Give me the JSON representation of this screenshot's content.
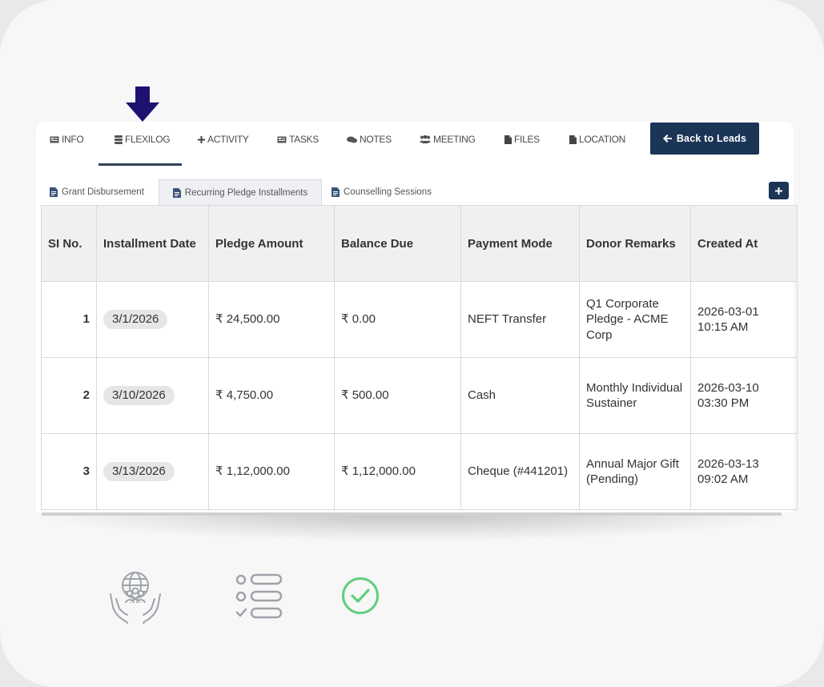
{
  "tabs": [
    {
      "label": "INFO",
      "icon": "id-card-icon"
    },
    {
      "label": "FLEXILOG",
      "icon": "database-icon"
    },
    {
      "label": "ACTIVITY",
      "icon": "plus-icon"
    },
    {
      "label": "TASKS",
      "icon": "id-card-icon"
    },
    {
      "label": "NOTES",
      "icon": "comments-icon"
    },
    {
      "label": "MEETING",
      "icon": "users-icon"
    },
    {
      "label": "FILES",
      "icon": "file-icon"
    },
    {
      "label": "LOCATION",
      "icon": "file-icon"
    }
  ],
  "active_tab": "FLEXILOG",
  "back_button": {
    "label": "Back to Leads",
    "icon": "arrow-left-icon"
  },
  "subtabs": [
    {
      "label": "Grant Disbursement",
      "icon": "document-icon"
    },
    {
      "label": "Recurring Pledge Installments",
      "icon": "document-icon"
    },
    {
      "label": "Counselling Sessions",
      "icon": "document-icon"
    }
  ],
  "active_subtab": "Recurring Pledge Installments",
  "table": {
    "columns": [
      "SI No.",
      "Installment Date",
      "Pledge Amount",
      "Balance Due",
      "Payment Mode",
      "Donor Remarks",
      "Created At"
    ],
    "rows": [
      {
        "si": "1",
        "date": "3/1/2026",
        "pledge": "₹ 24,500.00",
        "balance": "₹ 0.00",
        "mode": "NEFT Transfer",
        "remarks": "Q1 Corporate Pledge - ACME Corp",
        "created": "2026-03-01 10:15 AM"
      },
      {
        "si": "2",
        "date": "3/10/2026",
        "pledge": "₹ 4,750.00",
        "balance": "₹ 500.00",
        "mode": "Cash",
        "remarks": "Monthly Individual Sustainer",
        "created": "2026-03-10 03:30 PM"
      },
      {
        "si": "3",
        "date": "3/13/2026",
        "pledge": "₹ 1,12,000.00",
        "balance": "₹ 1,12,000.00",
        "mode": "Cheque (#441201)",
        "remarks": "Annual Major Gift (Pending)",
        "created": "2026-03-13 09:02 AM"
      }
    ]
  },
  "bottom_icons": [
    "hands-globe-icon",
    "checklist-icon",
    "check-circle-icon"
  ],
  "colors": {
    "accent": "#1b3557",
    "arrow": "#1e1270",
    "success": "#5fcf7d",
    "icon_gray": "#9ea3a9"
  }
}
